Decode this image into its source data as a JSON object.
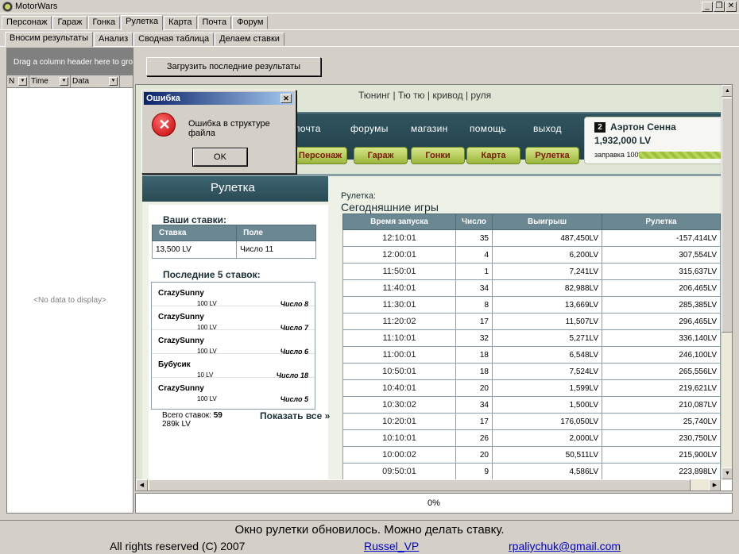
{
  "window": {
    "title": "MotorWars"
  },
  "main_tabs": [
    "Персонаж",
    "Гараж",
    "Гонка",
    "Рулетка",
    "Карта",
    "Почта",
    "Форум"
  ],
  "sub_tabs": [
    "Вносим результаты",
    "Анализ",
    "Сводная таблица",
    "Делаем ставки"
  ],
  "grid": {
    "group_hint": "Drag a column header here to group by that column",
    "columns": [
      "N",
      "Time",
      "Data"
    ],
    "empty_text": "<No data to display>"
  },
  "load_button": "Загрузить последние результаты",
  "site": {
    "top_links": "Тюнинг | Тю тю | кривод | руля",
    "nav": [
      "почта",
      "форумы",
      "магазин",
      "помощь",
      "выход"
    ],
    "buttons": [
      "Персонаж",
      "Гараж",
      "Гонки",
      "Карта",
      "Рулетка"
    ],
    "player": {
      "rank": "2",
      "name": "Аэртон Сенна",
      "money": "1,932,000 LV",
      "fuel_label": "заправка 100%",
      "fuel": 1.0
    },
    "roulette_title": "Рулетка",
    "your_bets_title": "Ваши ставки:",
    "bets_headers": [
      "Ставка",
      "Поле"
    ],
    "bets_row": [
      "13,500 LV",
      "Число 11"
    ],
    "last5_title": "Последние 5 ставок:",
    "last5": [
      {
        "name": "CrazySunny",
        "amount": "100 LV",
        "field": "Число 8"
      },
      {
        "name": "CrazySunny",
        "amount": "100 LV",
        "field": "Число 7"
      },
      {
        "name": "CrazySunny",
        "amount": "100 LV",
        "field": "Число 6"
      },
      {
        "name": "Бубусик",
        "amount": "10 LV",
        "field": "Число 18"
      },
      {
        "name": "CrazySunny",
        "amount": "100 LV",
        "field": "Число 5"
      }
    ],
    "total_label": "Всего ставок:",
    "total_value": "59",
    "total_sum": "289k LV",
    "show_all": "Показать все »",
    "games_label": "Рулетка:",
    "games_title": "Сегодняшние игры",
    "games_headers": [
      "Время запуска",
      "Число",
      "Выигрыш",
      "Рулетка"
    ],
    "games": [
      [
        "12:10:01",
        "35",
        "487,450LV",
        "-157,414LV"
      ],
      [
        "12:00:01",
        "4",
        "6,200LV",
        "307,554LV"
      ],
      [
        "11:50:01",
        "1",
        "7,241LV",
        "315,637LV"
      ],
      [
        "11:40:01",
        "34",
        "82,988LV",
        "206,465LV"
      ],
      [
        "11:30:01",
        "8",
        "13,669LV",
        "285,385LV"
      ],
      [
        "11:20:02",
        "17",
        "11,507LV",
        "296,465LV"
      ],
      [
        "11:10:01",
        "32",
        "5,271LV",
        "336,140LV"
      ],
      [
        "11:00:01",
        "18",
        "6,548LV",
        "246,100LV"
      ],
      [
        "10:50:01",
        "18",
        "7,524LV",
        "265,556LV"
      ],
      [
        "10:40:01",
        "20",
        "1,599LV",
        "219,621LV"
      ],
      [
        "10:30:02",
        "34",
        "1,500LV",
        "210,087LV"
      ],
      [
        "10:20:01",
        "17",
        "176,050LV",
        "25,740LV"
      ],
      [
        "10:10:01",
        "26",
        "2,000LV",
        "230,750LV"
      ],
      [
        "10:00:02",
        "20",
        "50,511LV",
        "215,900LV"
      ],
      [
        "09:50:01",
        "9",
        "4,586LV",
        "223,898LV"
      ]
    ]
  },
  "progress": "0%",
  "status": "Окно рулетки обновилось. Можно делать ставку.",
  "footer": {
    "rights": "All rights reserved (C) 2007",
    "author": "Russel_VP",
    "email": "rpaliychuk@gmail.com"
  },
  "dialog": {
    "title": "Ошибка",
    "message": "Ошибка в структуре файла",
    "ok": "OK"
  }
}
